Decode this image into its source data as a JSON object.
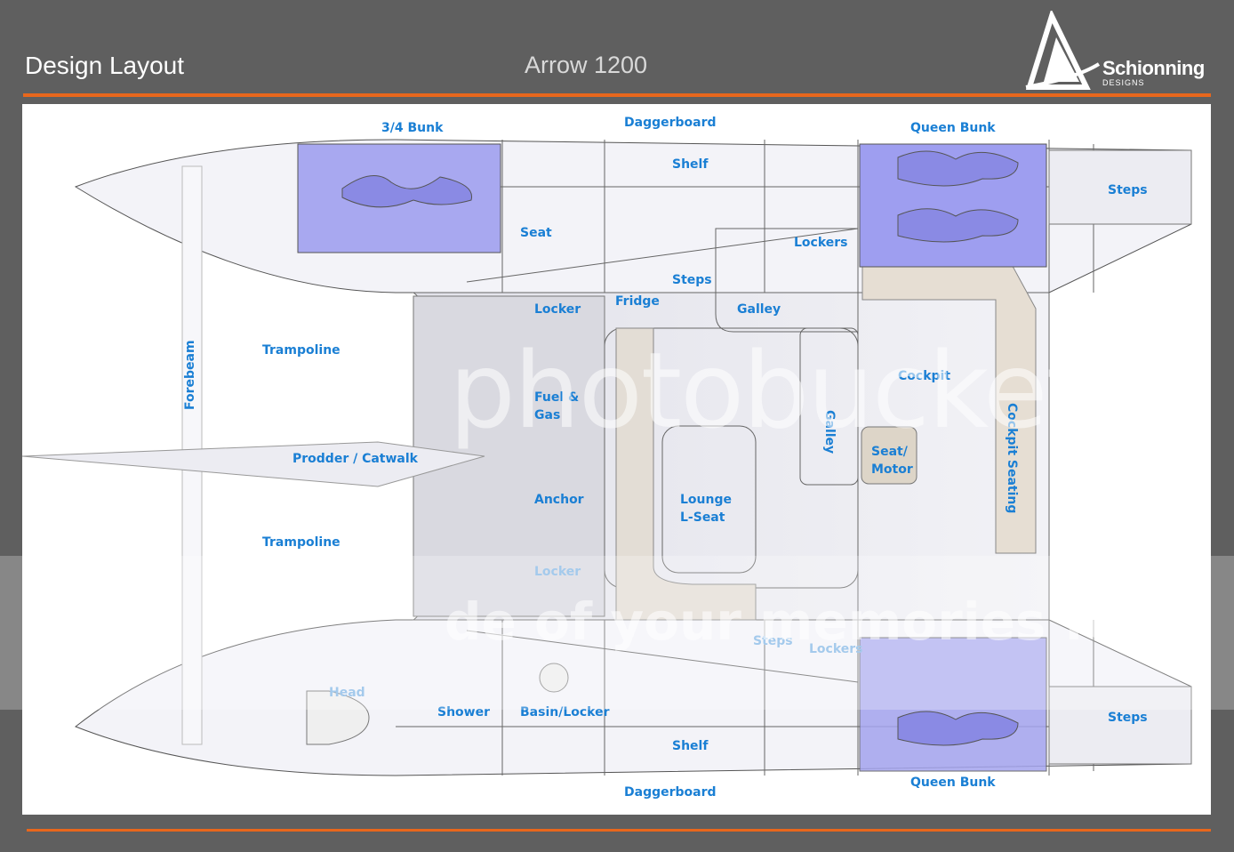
{
  "header": {
    "title": "Design Layout",
    "subtitle": "Arrow 1200",
    "logo_text": "Schionning",
    "logo_sub": "DESIGNS"
  },
  "colors": {
    "accent": "#e8671c",
    "label": "#1a7fd4",
    "bunk": "#8f8ff0",
    "seating": "#e6ded3"
  },
  "labels": {
    "bunk34": "3/4 Bunk",
    "daggerboard_top": "Daggerboard",
    "queen_bunk_top": "Queen Bunk",
    "shelf_top": "Shelf",
    "steps_top": "Steps",
    "seat": "Seat",
    "lockers_top": "Lockers",
    "steps_mid": "Steps",
    "locker_top": "Locker",
    "fridge": "Fridge",
    "galley": "Galley",
    "trampoline_top": "Trampoline",
    "forebeam": "Forebeam",
    "cockpit": "Cockpit",
    "fuel_1": "Fuel &",
    "fuel_2": "Gas",
    "galley_vert": "Galley",
    "cockpit_seating": "Cockpit Seating",
    "seat_motor_1": "Seat/",
    "seat_motor_2": "Motor",
    "prodder": "Prodder / Catwalk",
    "anchor": "Anchor",
    "lounge_1": "Lounge",
    "lounge_2": "L-Seat",
    "trampoline_bottom": "Trampoline",
    "locker_bottom": "Locker",
    "steps_lower": "Steps",
    "lockers_lower": "Lockers",
    "head": "Head",
    "shower": "Shower",
    "basin": "Basin/Locker",
    "steps_bottom": "Steps",
    "shelf_bottom": "Shelf",
    "daggerboard_bottom": "Daggerboard",
    "queen_bunk_bottom": "Queen Bunk"
  },
  "watermark": {
    "text": "photobucket",
    "tagline": "de    of your memories for"
  }
}
